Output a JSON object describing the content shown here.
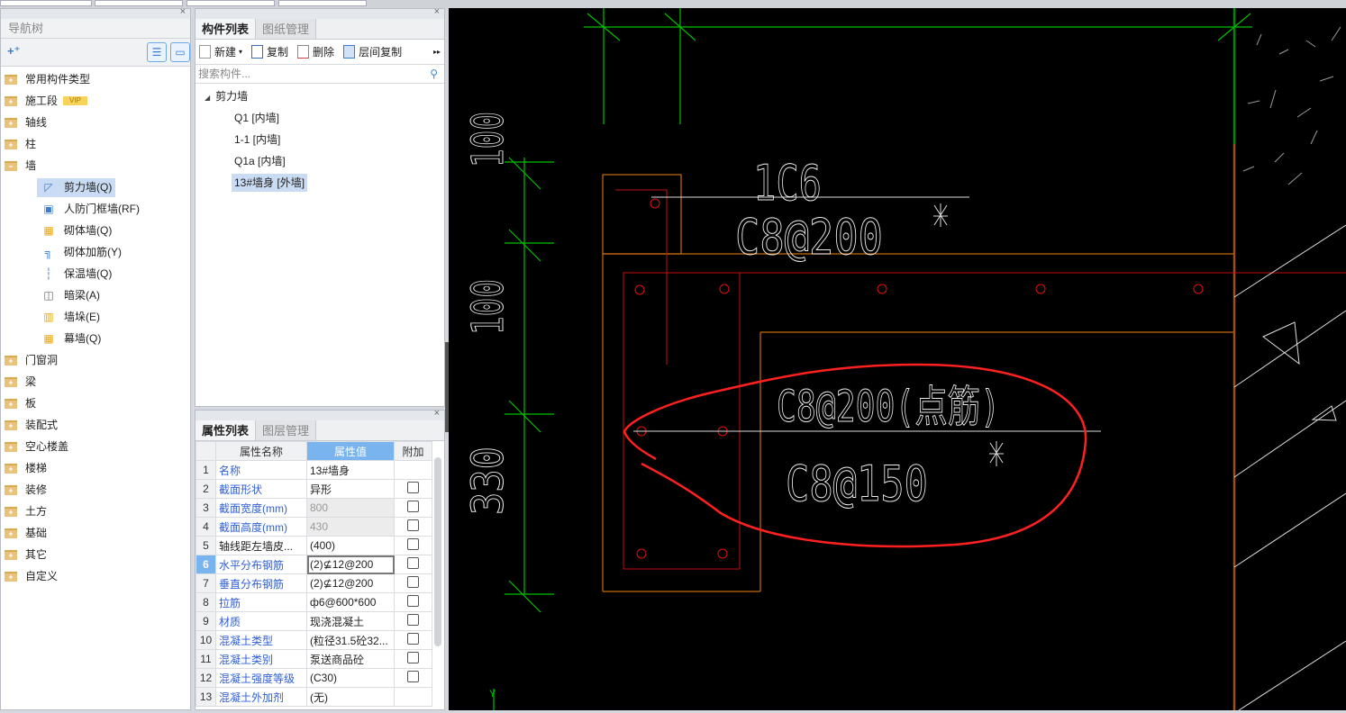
{
  "nav": {
    "title": "导航树",
    "close": "×",
    "items": [
      {
        "label": "常用构件类型"
      },
      {
        "label": "施工段",
        "badge": "VIP"
      },
      {
        "label": "轴线"
      },
      {
        "label": "柱"
      },
      {
        "label": "墙",
        "expanded": true,
        "children": [
          {
            "label": "剪力墙(Q)",
            "icon": "shear-wall-icon",
            "selected": true
          },
          {
            "label": "人防门框墙(RF)",
            "icon": "door-frame-wall-icon"
          },
          {
            "label": "砌体墙(Q)",
            "icon": "masonry-wall-icon"
          },
          {
            "label": "砌体加筋(Y)",
            "icon": "masonry-rebar-icon"
          },
          {
            "label": "保温墙(Q)",
            "icon": "insulation-wall-icon"
          },
          {
            "label": "暗梁(A)",
            "icon": "hidden-beam-icon"
          },
          {
            "label": "墙垛(E)",
            "icon": "wall-pier-icon"
          },
          {
            "label": "幕墙(Q)",
            "icon": "curtain-wall-icon"
          }
        ]
      },
      {
        "label": "门窗洞"
      },
      {
        "label": "梁"
      },
      {
        "label": "板"
      },
      {
        "label": "装配式"
      },
      {
        "label": "空心楼盖"
      },
      {
        "label": "楼梯"
      },
      {
        "label": "装修"
      },
      {
        "label": "土方"
      },
      {
        "label": "基础"
      },
      {
        "label": "其它"
      },
      {
        "label": "自定义"
      }
    ]
  },
  "components": {
    "tabs": [
      "构件列表",
      "图纸管理"
    ],
    "toolbar": {
      "new": "新建",
      "copy": "复制",
      "delete": "删除",
      "floor_copy": "层间复制",
      "more": "▸▸"
    },
    "search_placeholder": "搜索构件...",
    "group": "剪力墙",
    "items": [
      "Q1 [内墙]",
      "1-1 [内墙]",
      "Q1a [内墙]",
      "13#墙身 [外墙]"
    ],
    "selected_index": 3
  },
  "properties": {
    "tabs": [
      "属性列表",
      "图层管理"
    ],
    "headers": [
      "属性名称",
      "属性值",
      "附加"
    ],
    "rows": [
      {
        "n": "1",
        "name": "名称",
        "value": "13#墙身",
        "checkbox": false
      },
      {
        "n": "2",
        "name": "截面形状",
        "value": "异形",
        "checkbox": true
      },
      {
        "n": "3",
        "name": "截面宽度(mm)",
        "value": "800",
        "checkbox": true,
        "disabled": true
      },
      {
        "n": "4",
        "name": "截面高度(mm)",
        "value": "430",
        "checkbox": true,
        "disabled": true
      },
      {
        "n": "5",
        "name": "轴线距左墙皮...",
        "value": "(400)",
        "checkbox": true,
        "black": true
      },
      {
        "n": "6",
        "name": "水平分布钢筋",
        "value": "(2)⊈12@200",
        "checkbox": true,
        "selected": true
      },
      {
        "n": "7",
        "name": "垂直分布钢筋",
        "value": "(2)⊈12@200",
        "checkbox": true
      },
      {
        "n": "8",
        "name": "拉筋",
        "value": "ф6@600*600",
        "checkbox": true
      },
      {
        "n": "9",
        "name": "材质",
        "value": "现浇混凝土",
        "checkbox": true
      },
      {
        "n": "10",
        "name": "混凝土类型",
        "value": "(粒径31.5砼32...",
        "checkbox": true
      },
      {
        "n": "11",
        "name": "混凝土类别",
        "value": "泵送商品砼",
        "checkbox": true
      },
      {
        "n": "12",
        "name": "混凝土强度等级",
        "value": "(C30)",
        "checkbox": true
      },
      {
        "n": "13",
        "name": "混凝土外加剂",
        "value": "(无)",
        "checkbox": false
      }
    ]
  },
  "cad": {
    "texts": {
      "t1": "1C6",
      "t2": "C8@200",
      "t3": "C8@200(点筋)",
      "t4": "C8@150",
      "d1": "100",
      "d2": "100",
      "d3": "330",
      "axis": "Y"
    },
    "colors": {
      "axis": "#00c000",
      "wall": "#c86a10",
      "rebar": "#d01010",
      "text": "#ffffff",
      "markup": "#ff2020"
    }
  }
}
